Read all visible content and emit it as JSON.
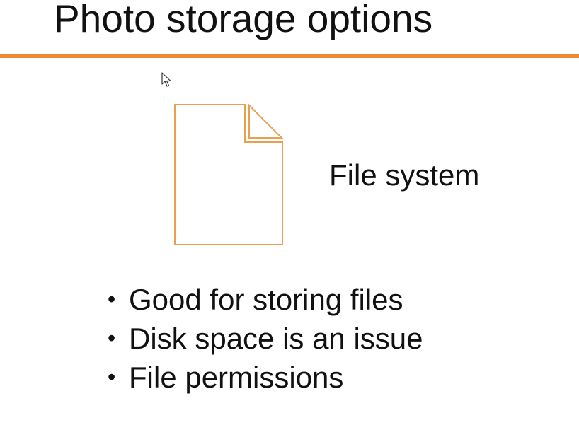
{
  "slide": {
    "title": "Photo storage options",
    "accent_color": "#ee8a30",
    "icon": "document-file-icon",
    "file_label": "File system",
    "bullet_glyph": "•",
    "bullets": [
      "Good for storing files",
      "Disk space is an issue",
      "File permissions"
    ]
  }
}
